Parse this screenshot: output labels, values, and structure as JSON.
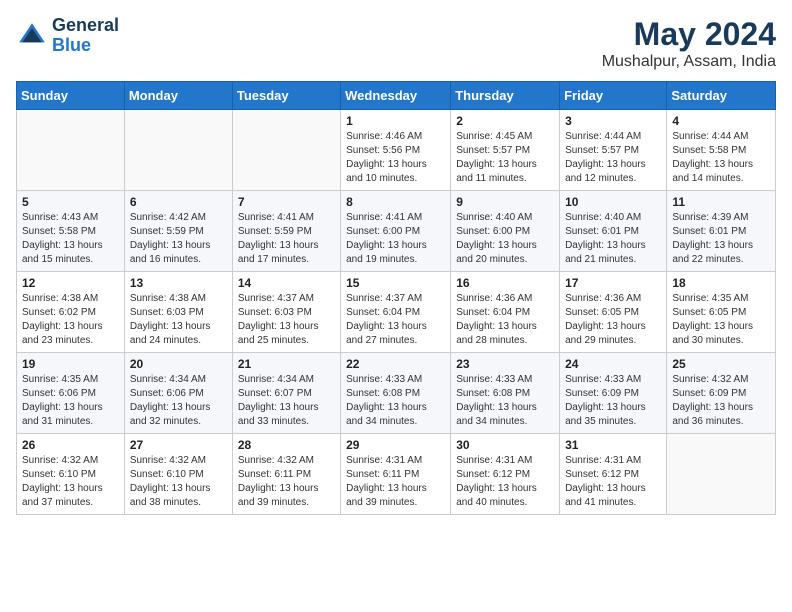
{
  "header": {
    "logo_line1": "General",
    "logo_line2": "Blue",
    "title": "May 2024",
    "subtitle": "Mushalpur, Assam, India"
  },
  "weekdays": [
    "Sunday",
    "Monday",
    "Tuesday",
    "Wednesday",
    "Thursday",
    "Friday",
    "Saturday"
  ],
  "weeks": [
    [
      {
        "day": "",
        "info": ""
      },
      {
        "day": "",
        "info": ""
      },
      {
        "day": "",
        "info": ""
      },
      {
        "day": "1",
        "info": "Sunrise: 4:46 AM\nSunset: 5:56 PM\nDaylight: 13 hours and 10 minutes."
      },
      {
        "day": "2",
        "info": "Sunrise: 4:45 AM\nSunset: 5:57 PM\nDaylight: 13 hours and 11 minutes."
      },
      {
        "day": "3",
        "info": "Sunrise: 4:44 AM\nSunset: 5:57 PM\nDaylight: 13 hours and 12 minutes."
      },
      {
        "day": "4",
        "info": "Sunrise: 4:44 AM\nSunset: 5:58 PM\nDaylight: 13 hours and 14 minutes."
      }
    ],
    [
      {
        "day": "5",
        "info": "Sunrise: 4:43 AM\nSunset: 5:58 PM\nDaylight: 13 hours and 15 minutes."
      },
      {
        "day": "6",
        "info": "Sunrise: 4:42 AM\nSunset: 5:59 PM\nDaylight: 13 hours and 16 minutes."
      },
      {
        "day": "7",
        "info": "Sunrise: 4:41 AM\nSunset: 5:59 PM\nDaylight: 13 hours and 17 minutes."
      },
      {
        "day": "8",
        "info": "Sunrise: 4:41 AM\nSunset: 6:00 PM\nDaylight: 13 hours and 19 minutes."
      },
      {
        "day": "9",
        "info": "Sunrise: 4:40 AM\nSunset: 6:00 PM\nDaylight: 13 hours and 20 minutes."
      },
      {
        "day": "10",
        "info": "Sunrise: 4:40 AM\nSunset: 6:01 PM\nDaylight: 13 hours and 21 minutes."
      },
      {
        "day": "11",
        "info": "Sunrise: 4:39 AM\nSunset: 6:01 PM\nDaylight: 13 hours and 22 minutes."
      }
    ],
    [
      {
        "day": "12",
        "info": "Sunrise: 4:38 AM\nSunset: 6:02 PM\nDaylight: 13 hours and 23 minutes."
      },
      {
        "day": "13",
        "info": "Sunrise: 4:38 AM\nSunset: 6:03 PM\nDaylight: 13 hours and 24 minutes."
      },
      {
        "day": "14",
        "info": "Sunrise: 4:37 AM\nSunset: 6:03 PM\nDaylight: 13 hours and 25 minutes."
      },
      {
        "day": "15",
        "info": "Sunrise: 4:37 AM\nSunset: 6:04 PM\nDaylight: 13 hours and 27 minutes."
      },
      {
        "day": "16",
        "info": "Sunrise: 4:36 AM\nSunset: 6:04 PM\nDaylight: 13 hours and 28 minutes."
      },
      {
        "day": "17",
        "info": "Sunrise: 4:36 AM\nSunset: 6:05 PM\nDaylight: 13 hours and 29 minutes."
      },
      {
        "day": "18",
        "info": "Sunrise: 4:35 AM\nSunset: 6:05 PM\nDaylight: 13 hours and 30 minutes."
      }
    ],
    [
      {
        "day": "19",
        "info": "Sunrise: 4:35 AM\nSunset: 6:06 PM\nDaylight: 13 hours and 31 minutes."
      },
      {
        "day": "20",
        "info": "Sunrise: 4:34 AM\nSunset: 6:06 PM\nDaylight: 13 hours and 32 minutes."
      },
      {
        "day": "21",
        "info": "Sunrise: 4:34 AM\nSunset: 6:07 PM\nDaylight: 13 hours and 33 minutes."
      },
      {
        "day": "22",
        "info": "Sunrise: 4:33 AM\nSunset: 6:08 PM\nDaylight: 13 hours and 34 minutes."
      },
      {
        "day": "23",
        "info": "Sunrise: 4:33 AM\nSunset: 6:08 PM\nDaylight: 13 hours and 34 minutes."
      },
      {
        "day": "24",
        "info": "Sunrise: 4:33 AM\nSunset: 6:09 PM\nDaylight: 13 hours and 35 minutes."
      },
      {
        "day": "25",
        "info": "Sunrise: 4:32 AM\nSunset: 6:09 PM\nDaylight: 13 hours and 36 minutes."
      }
    ],
    [
      {
        "day": "26",
        "info": "Sunrise: 4:32 AM\nSunset: 6:10 PM\nDaylight: 13 hours and 37 minutes."
      },
      {
        "day": "27",
        "info": "Sunrise: 4:32 AM\nSunset: 6:10 PM\nDaylight: 13 hours and 38 minutes."
      },
      {
        "day": "28",
        "info": "Sunrise: 4:32 AM\nSunset: 6:11 PM\nDaylight: 13 hours and 39 minutes."
      },
      {
        "day": "29",
        "info": "Sunrise: 4:31 AM\nSunset: 6:11 PM\nDaylight: 13 hours and 39 minutes."
      },
      {
        "day": "30",
        "info": "Sunrise: 4:31 AM\nSunset: 6:12 PM\nDaylight: 13 hours and 40 minutes."
      },
      {
        "day": "31",
        "info": "Sunrise: 4:31 AM\nSunset: 6:12 PM\nDaylight: 13 hours and 41 minutes."
      },
      {
        "day": "",
        "info": ""
      }
    ]
  ]
}
